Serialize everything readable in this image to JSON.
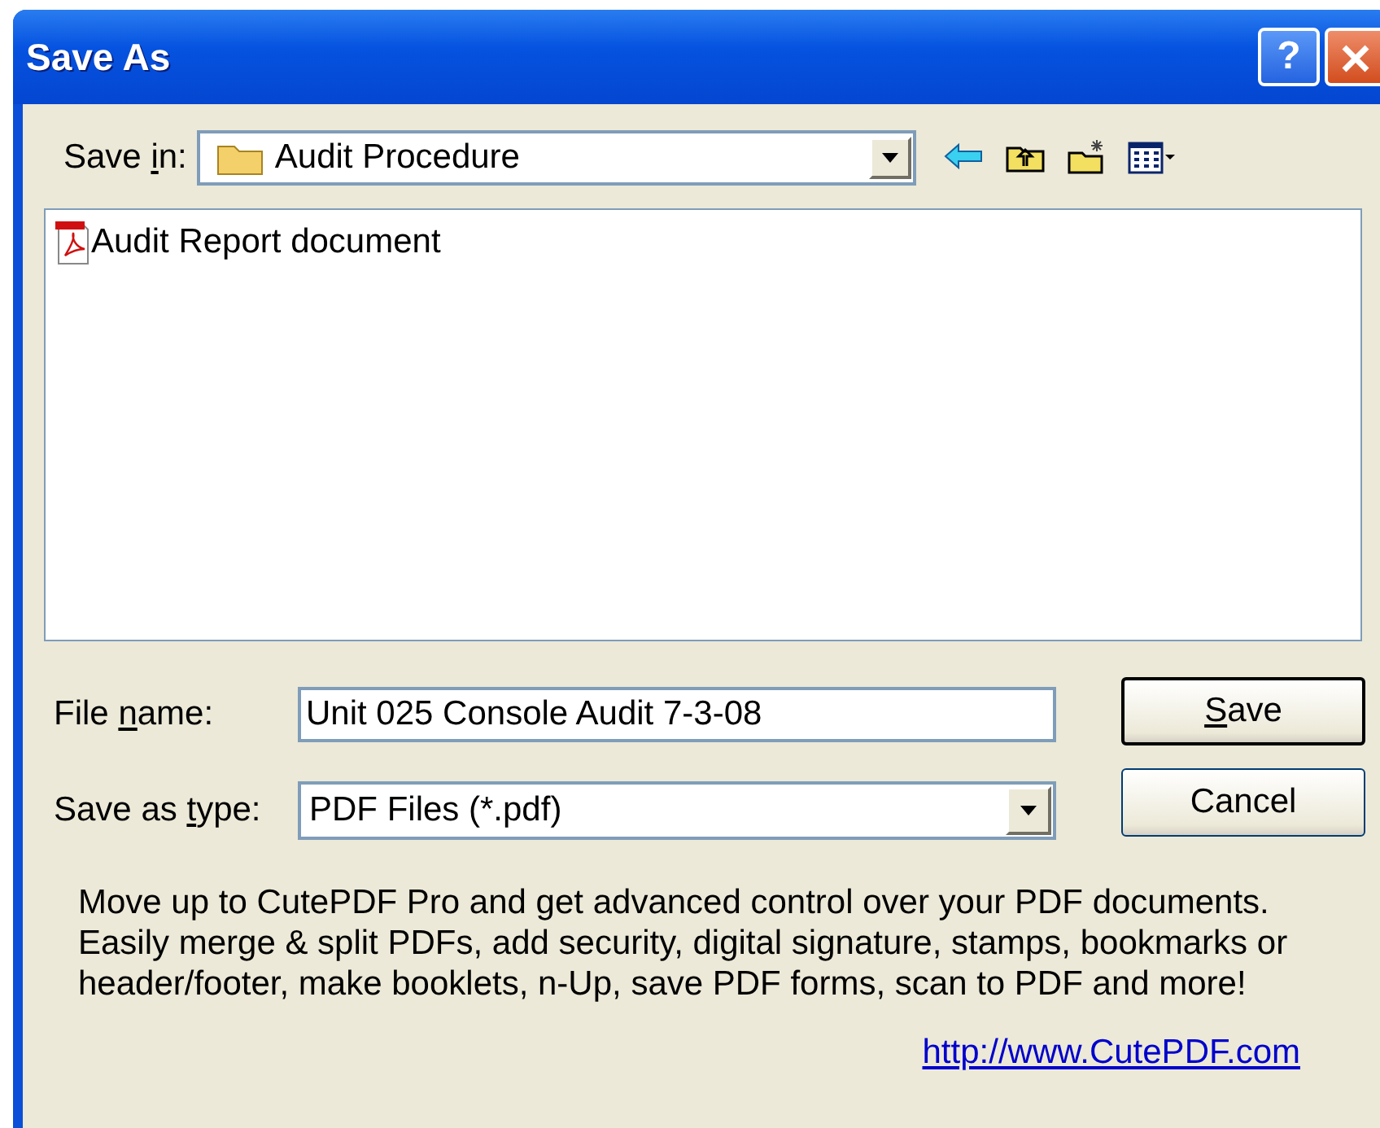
{
  "window": {
    "title": "Save As",
    "buttons": [
      {
        "kind": "help",
        "label": "?"
      },
      {
        "kind": "close"
      }
    ]
  },
  "save_in": {
    "label": {
      "pre": "Save ",
      "key": "i",
      "post": "n:"
    },
    "value": "Audit Procedure"
  },
  "toolbar": [
    {
      "kind": "back"
    },
    {
      "kind": "up"
    },
    {
      "kind": "new-folder"
    },
    {
      "kind": "views"
    }
  ],
  "files": [
    {
      "name": "Audit Report document",
      "kind": "pdf",
      "selected": false
    }
  ],
  "file_name": {
    "label": {
      "pre": "File ",
      "key": "n",
      "post": "ame:"
    },
    "value": "Unit 025 Console Audit 7-3-08"
  },
  "save_as_type": {
    "label": {
      "pre": "Save as ",
      "key": "t",
      "post": "ype:"
    },
    "value": "PDF Files (*.pdf)"
  },
  "buttons": [
    {
      "label": {
        "key": "S",
        "post": "ave"
      },
      "default": true
    },
    {
      "label": {
        "pre": "Cancel"
      },
      "default": false
    }
  ],
  "promo": {
    "text": "Move up to CutePDF Pro and get advanced control over your PDF documents. Easily merge & split PDFs, add security, digital signature, stamps, bookmarks or header/footer, make booklets, n-Up, save PDF forms, scan to PDF and more!",
    "link": "http://www.CutePDF.com"
  }
}
